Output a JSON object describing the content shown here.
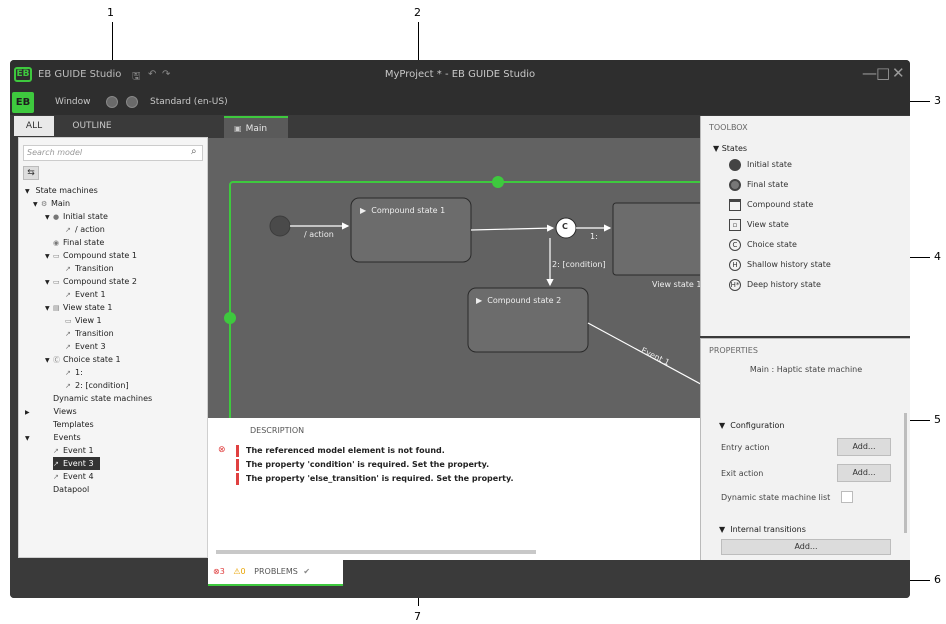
{
  "callouts": [
    "1",
    "2",
    "3",
    "4",
    "5",
    "6",
    "7"
  ],
  "titlebar": {
    "logo": "EB",
    "app_name": "EB GUIDE Studio",
    "icons": [
      "save-icon",
      "undo-icon",
      "redo-icon"
    ],
    "window_title": "MyProject * - EB GUIDE Studio",
    "controls": [
      "—",
      "□",
      "✕"
    ]
  },
  "menubar": {
    "logo": "EB",
    "window_label": "Window",
    "language": "Standard (en-US)"
  },
  "left_tabs": [
    "ALL",
    "OUTLINE"
  ],
  "search": {
    "placeholder": "Search model"
  },
  "tree": [
    {
      "label": "State machines",
      "expander": "▼",
      "icon": ""
    },
    {
      "label": "Main",
      "expander": "▼",
      "icon": "⚙"
    },
    {
      "label": "Initial state",
      "expander": "▼",
      "icon": "●"
    },
    {
      "label": "/ action",
      "expander": "",
      "icon": "↗"
    },
    {
      "label": "Final state",
      "expander": "",
      "icon": "◉"
    },
    {
      "label": "Compound state 1",
      "expander": "▼",
      "icon": "▭"
    },
    {
      "label": "Transition",
      "expander": "",
      "icon": "↗"
    },
    {
      "label": "Compound state 2",
      "expander": "▼",
      "icon": "▭"
    },
    {
      "label": "Event 1",
      "expander": "",
      "icon": "↗"
    },
    {
      "label": "View state 1",
      "expander": "▼",
      "icon": "▤"
    },
    {
      "label": "View 1",
      "expander": "",
      "icon": "▭"
    },
    {
      "label": "Transition",
      "expander": "",
      "icon": "↗"
    },
    {
      "label": "Event 3",
      "expander": "",
      "icon": "↗"
    },
    {
      "label": "Choice state 1",
      "expander": "▼",
      "icon": "Ⓒ"
    },
    {
      "label": "1:",
      "expander": "",
      "icon": "↗"
    },
    {
      "label": "2: [condition]",
      "expander": "",
      "icon": "↗"
    },
    {
      "label": "Dynamic state machines",
      "expander": "",
      "icon": ""
    },
    {
      "label": "Views",
      "expander": "▶",
      "icon": ""
    },
    {
      "label": "Templates",
      "expander": "",
      "icon": ""
    },
    {
      "label": "Events",
      "expander": "▼",
      "icon": ""
    },
    {
      "label": "Event 1",
      "expander": "",
      "icon": "↗"
    },
    {
      "label": "Event 3",
      "expander": "",
      "icon": "↗"
    },
    {
      "label": "Event 4",
      "expander": "",
      "icon": "↗"
    },
    {
      "label": "Datapool",
      "expander": "",
      "icon": ""
    }
  ],
  "editor_tab": {
    "label": "Main"
  },
  "canvas": {
    "compound1": "Compound state 1",
    "compound2": "Compound state 2",
    "view_state": "View state 1",
    "action_label": "/ action",
    "one_label": "1:",
    "condition_label": "2: [condition]",
    "event_label": "Event 1",
    "choice_glyph": "C"
  },
  "problems": {
    "header": "DESCRIPTION",
    "errors": [
      "The referenced model element is not found.",
      "The property 'condition' is required. Set the property.",
      "The property 'else_transition' is required. Set the property."
    ],
    "tab": {
      "errors": "3",
      "warnings": "0",
      "label": "PROBLEMS"
    }
  },
  "toolbox": {
    "title": "TOOLBOX",
    "section": "States",
    "items": [
      {
        "label": "Initial state",
        "icon": "initial-state-icon"
      },
      {
        "label": "Final state",
        "icon": "final-state-icon"
      },
      {
        "label": "Compound state",
        "icon": "compound-state-icon"
      },
      {
        "label": "View state",
        "icon": "view-state-icon"
      },
      {
        "label": "Choice state",
        "icon": "choice-state-icon"
      },
      {
        "label": "Shallow history state",
        "icon": "shallow-history-icon"
      },
      {
        "label": "Deep history state",
        "icon": "deep-history-icon"
      }
    ]
  },
  "properties": {
    "title": "PROPERTIES",
    "subtitle": "Main : Haptic state machine",
    "configuration": "Configuration",
    "entry_action": "Entry action",
    "exit_action": "Exit action",
    "dynamic_list": "Dynamic state machine list",
    "add": "Add...",
    "internal_transitions": "Internal transitions"
  },
  "colors": {
    "accent": "#3ec93e",
    "error": "#e04040",
    "warning": "#e9a300"
  }
}
